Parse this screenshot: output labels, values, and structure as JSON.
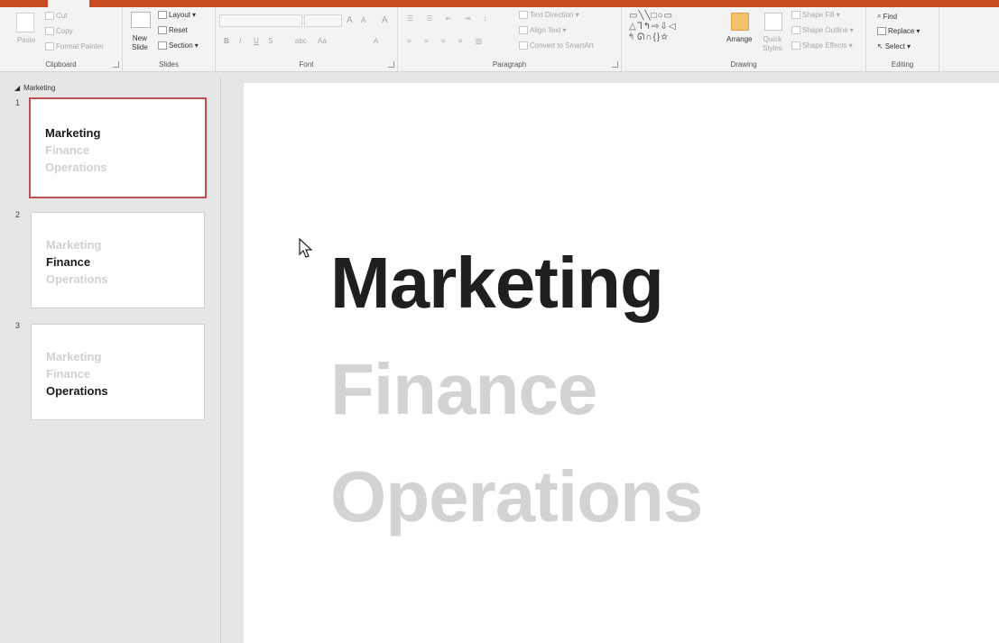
{
  "ribbon": {
    "clipboard": {
      "group_label": "Clipboard",
      "paste": "Paste",
      "cut": "Cut",
      "copy": "Copy",
      "format_painter": "Format Painter"
    },
    "slides": {
      "group_label": "Slides",
      "new_slide_line1": "New",
      "new_slide_line2": "Slide",
      "layout": "Layout",
      "reset": "Reset",
      "section": "Section"
    },
    "font": {
      "group_label": "Font",
      "bold": "B",
      "italic": "I",
      "underline": "U",
      "strike": "S",
      "spacing": "abc",
      "case": "Aa",
      "grow": "A",
      "shrink": "A",
      "clear": "A",
      "color": "A"
    },
    "paragraph": {
      "group_label": "Paragraph",
      "text_direction": "Text Direction",
      "align_text": "Align Text",
      "convert_smartart": "Convert to SmartArt"
    },
    "drawing": {
      "group_label": "Drawing",
      "arrange": "Arrange",
      "quick_styles_line1": "Quick",
      "quick_styles_line2": "Styles",
      "shape_fill": "Shape Fill",
      "shape_outline": "Shape Outline",
      "shape_effects": "Shape Effects"
    },
    "editing": {
      "group_label": "Editing",
      "find": "Find",
      "replace": "Replace",
      "select": "Select"
    }
  },
  "outline": {
    "section_name": "Marketing",
    "slides": [
      {
        "number": "1",
        "lines": [
          "Marketing",
          "Finance",
          "Operations"
        ],
        "active_index": 0
      },
      {
        "number": "2",
        "lines": [
          "Marketing",
          "Finance",
          "Operations"
        ],
        "active_index": 1
      },
      {
        "number": "3",
        "lines": [
          "Marketing",
          "Finance",
          "Operations"
        ],
        "active_index": 2
      }
    ]
  },
  "slide": {
    "line1": "Marketing",
    "line2": "Finance",
    "line3": "Operations"
  },
  "colors": {
    "accent": "#c84b22",
    "selected_border": "#c0504d",
    "active_text": "#1f1f1f",
    "inactive_text": "#d3d3d3"
  }
}
